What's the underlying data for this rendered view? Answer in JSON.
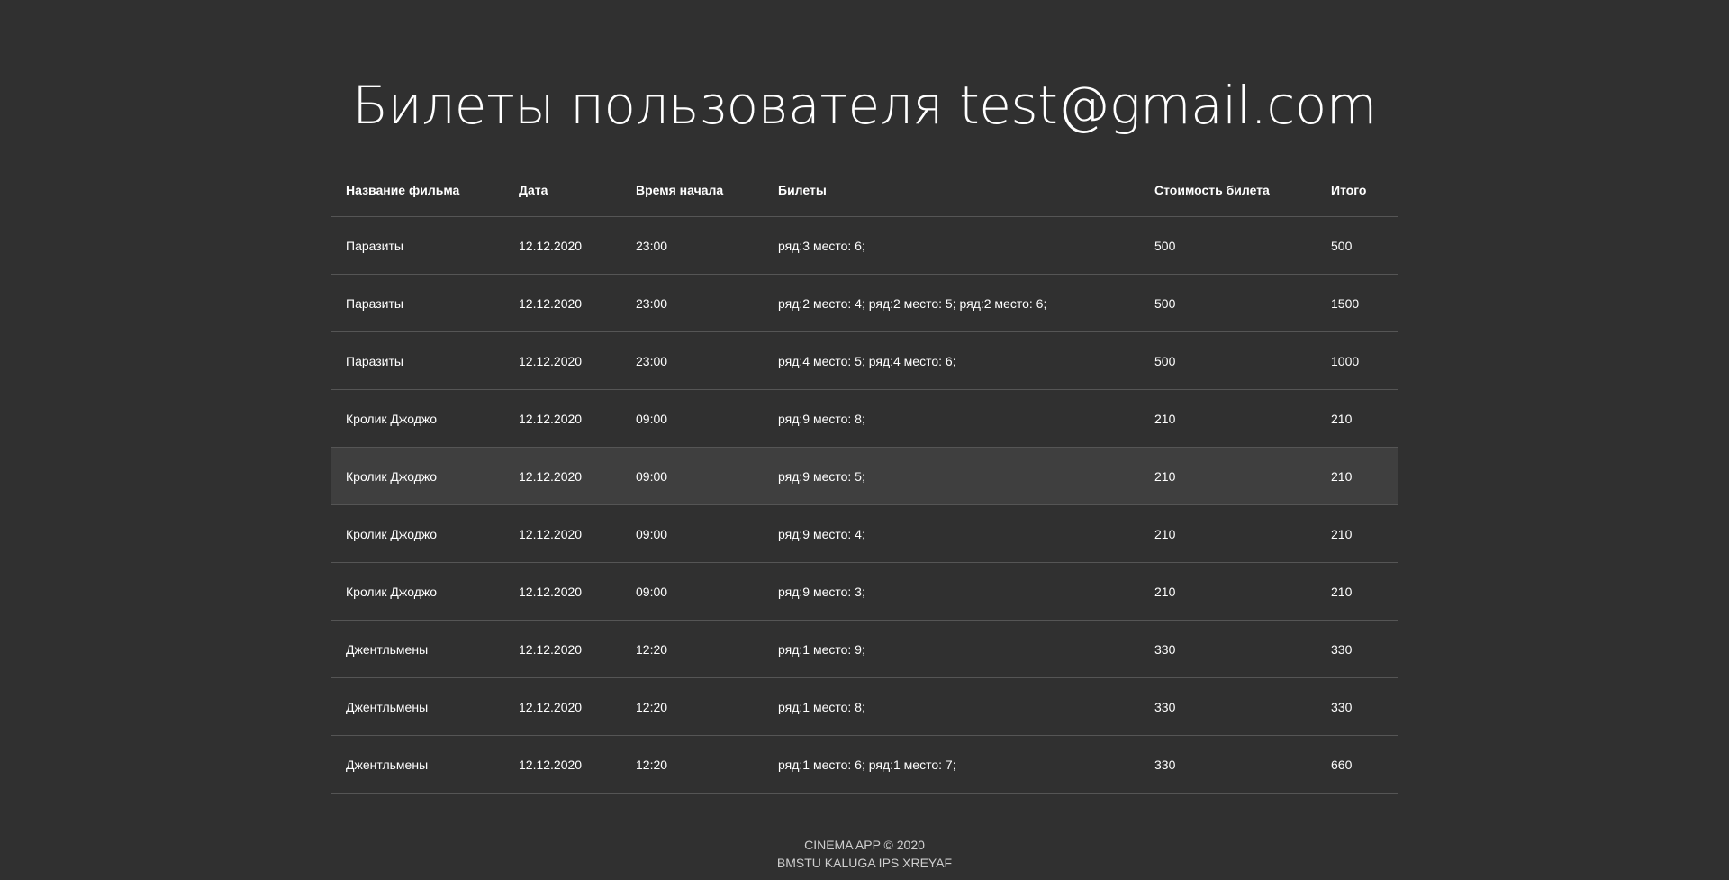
{
  "page": {
    "title": "Билеты пользователя test@gmail.com"
  },
  "table": {
    "headers": [
      "Название фильма",
      "Дата",
      "Время начала",
      "Билеты",
      "Стоимость билета",
      "Итого"
    ],
    "rows": [
      [
        "Паразиты",
        "12.12.2020",
        "23:00",
        "ряд:3 место: 6;",
        "500",
        "500"
      ],
      [
        "Паразиты",
        "12.12.2020",
        "23:00",
        "ряд:2 место: 4; ряд:2 место: 5; ряд:2 место: 6;",
        "500",
        "1500"
      ],
      [
        "Паразиты",
        "12.12.2020",
        "23:00",
        "ряд:4 место: 5; ряд:4 место: 6;",
        "500",
        "1000"
      ],
      [
        "Кролик Джоджо",
        "12.12.2020",
        "09:00",
        "ряд:9 место: 8;",
        "210",
        "210"
      ],
      [
        "Кролик Джоджо",
        "12.12.2020",
        "09:00",
        "ряд:9 место: 5;",
        "210",
        "210"
      ],
      [
        "Кролик Джоджо",
        "12.12.2020",
        "09:00",
        "ряд:9 место: 4;",
        "210",
        "210"
      ],
      [
        "Кролик Джоджо",
        "12.12.2020",
        "09:00",
        "ряд:9 место: 3;",
        "210",
        "210"
      ],
      [
        "Джентльмены",
        "12.12.2020",
        "12:20",
        "ряд:1 место: 9;",
        "330",
        "330"
      ],
      [
        "Джентльмены",
        "12.12.2020",
        "12:20",
        "ряд:1 место: 8;",
        "330",
        "330"
      ],
      [
        "Джентльмены",
        "12.12.2020",
        "12:20",
        "ряд:1 место: 6; ряд:1 место: 7;",
        "330",
        "660"
      ]
    ]
  },
  "footer": {
    "line1": "CINEMA APP © 2020",
    "line2": "BMSTU KALUGA IPS XREYAF"
  },
  "colors": {
    "background": "#303030",
    "row_hover": "#3f3f3f",
    "divider": "#555555",
    "text": "#ffffff"
  }
}
